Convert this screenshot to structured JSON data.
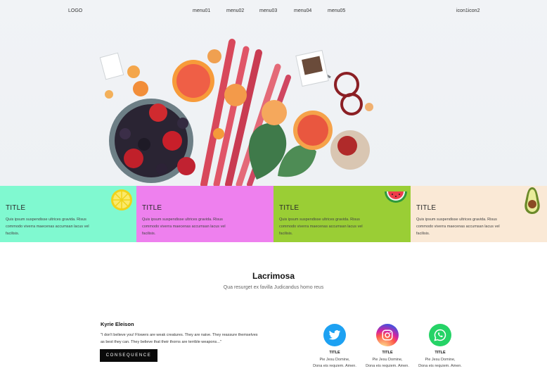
{
  "nav": {
    "logo": "LOGO",
    "menu": [
      "menu01",
      "menu02",
      "menu03",
      "menu04",
      "menu05"
    ],
    "icons": "icon1icon2"
  },
  "cards": [
    {
      "title": "TITLE",
      "text": "Quis ipsum suspendisse ultrices gravida. Risus commodo viverra maecenas accumsan lacus vel facilisis.",
      "color": "#80f9d0",
      "fruit": "lemon-icon"
    },
    {
      "title": "TITLE",
      "text": "Quis ipsum suspendisse ultrices gravida. Risus commodo viverra maecenas accumsan lacus vel facilisis.",
      "color": "#ee80ee",
      "fruit": "none"
    },
    {
      "title": "TITLE",
      "text": "Quis ipsum suspendisse ultrices gravida. Risus commodo viverra maecenas accumsan lacus vel facilisis.",
      "color": "#9ace35",
      "fruit": "watermelon-icon"
    },
    {
      "title": "TITLE",
      "text": "Quis ipsum suspendisse ultrices gravida. Risus commodo viverra maecenas accumsan lacus vel facilisis.",
      "color": "#fae9d6",
      "fruit": "avocado-icon"
    }
  ],
  "section": {
    "title": "Lacrimosa",
    "subtitle": "Qua resurget ex favilla Judicandus homo reus"
  },
  "quote": {
    "title": "Kyrie Eleison",
    "text": "\"I don't believe you! Flowers are weak creatures. They are naive. They reassure themselves as best they can. They believe that their thorns are terrible weapons...\"",
    "button": "CONSEQUENCE"
  },
  "social": [
    {
      "icon": "twitter-icon",
      "color": "#1da1f2",
      "title": "TITLE",
      "line1": "Pie Jesu Domine,",
      "line2": "Dona eis requiem. Amen."
    },
    {
      "icon": "instagram-icon",
      "color": "#c13584",
      "title": "TITLE",
      "line1": "Pie Jesu Domine,",
      "line2": "Dona eis requiem. Amen."
    },
    {
      "icon": "whatsapp-icon",
      "color": "#25d366",
      "title": "TITLE",
      "line1": "Pie Jesu Domine,",
      "line2": "Dona eis requiem. Amen."
    }
  ]
}
